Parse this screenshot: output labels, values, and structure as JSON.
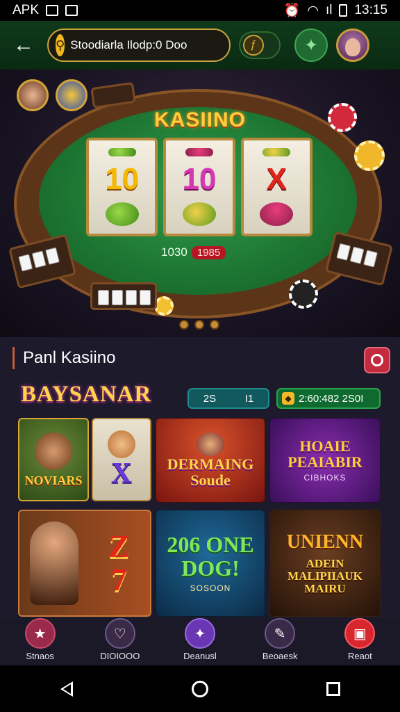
{
  "status_bar": {
    "left_text": "APK",
    "time": "13:15",
    "signal_text": "ıl"
  },
  "header": {
    "search_value": "Stoodiarla Ilodp:0 Doo",
    "back_icon": "arrow-left-icon",
    "friends_icon": "puzzle-icon",
    "profile_icon": "avatar-icon"
  },
  "hero": {
    "title": "KASIINO",
    "reels": [
      {
        "top": "10",
        "bottom_color": "green"
      },
      {
        "top": "10",
        "bottom_color": "leaf"
      },
      {
        "top": "X",
        "bottom_color": "dish"
      }
    ],
    "counter_a": "1030",
    "counter_b": "1985"
  },
  "section": {
    "title": "Panl Kasiino",
    "brand": "BAYSANAR",
    "pill_a": [
      "2S",
      "I1"
    ],
    "pill_b": "2:60:482 2S0I"
  },
  "tiles": [
    {
      "title": "NOVIARS",
      "sub": ""
    },
    {
      "title": "X",
      "sub": ""
    },
    {
      "title": "DERMAING Soude",
      "sub": ""
    },
    {
      "title": "HOAIE PEAIABIR",
      "sub": "CIBHOKS"
    },
    {
      "title": "Z 7",
      "sub": ""
    },
    {
      "title": "206 ONE DOG!",
      "sub": "SOSOON"
    },
    {
      "title": "UNIENN",
      "sub": "ADEIN MALIPIIAUK MAIRU"
    }
  ],
  "bottom_nav": [
    {
      "label": "Stnaos",
      "icon": "star-icon",
      "color": "#9a2a4c"
    },
    {
      "label": "DIOIOOO",
      "icon": "heart-icon",
      "color": "#3a2a48"
    },
    {
      "label": "Deanusl",
      "icon": "sparkle-star-icon",
      "color": "#6b36b3"
    },
    {
      "label": "Beoaesk",
      "icon": "speaker-icon",
      "color": "#3a2a48"
    },
    {
      "label": "Reaot",
      "icon": "chat-icon",
      "color": "#d8262e"
    }
  ]
}
